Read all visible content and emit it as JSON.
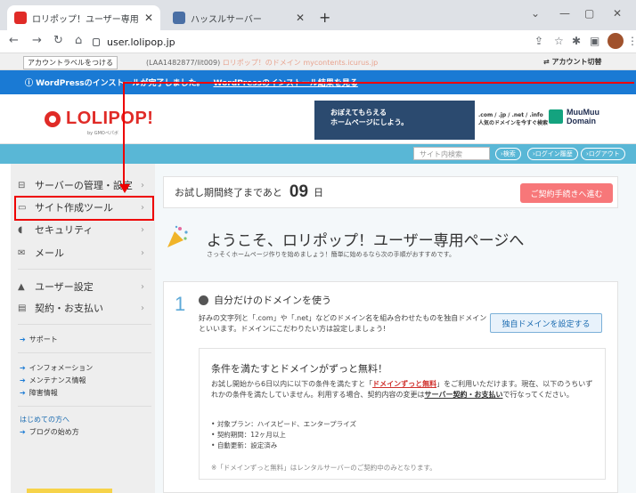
{
  "browser": {
    "tabs": [
      {
        "title": "ロリポップ！ユーザー専用ページ - イン",
        "active": true,
        "favicon_color": "#e02b27"
      },
      {
        "title": "ハッスルサーバー",
        "active": false,
        "favicon_color": "#4a6fa5"
      }
    ],
    "url": "user.lolipop.jp",
    "icons": [
      "back-icon",
      "forward-icon",
      "reload-icon",
      "home-icon",
      "lock-icon",
      "share-icon",
      "star-icon",
      "extensions-icon",
      "sidepanel-icon",
      "profile-avatar",
      "menu-icon"
    ]
  },
  "account_bar": {
    "label_button": "アカウントラベルをつける",
    "info_prefix": "(LAA1482877/lit009)",
    "info_domain": "ロリポップ！のドメイン mycontents.icurus.jp",
    "switch": "⇄ アカウント切替"
  },
  "notice": {
    "text": "ⓘ WordPressのインストールが完了しました。",
    "link": "WordPressのインストール結果を見る"
  },
  "header": {
    "logo": "LOLIPOP!",
    "logo_sub": "by GMOペパボ",
    "banner_line1": "おぼえてもらえる",
    "banner_line2": "ホームページにしよう。",
    "domain_text1": ".com / .jp / .net / .info",
    "domain_text2": "人気のドメインを今すぐ検索",
    "mm_line1": "MuuMuu",
    "mm_line2": "Domain"
  },
  "search": {
    "placeholder": "サイト内検索",
    "btn_search": "›検索",
    "btn_history": "›ログイン履歴",
    "btn_logout": "›ログアウト"
  },
  "sidebar": {
    "items": [
      {
        "icon": "server-icon",
        "glyph": "⊟",
        "label": "サーバーの管理・設定"
      },
      {
        "icon": "site-icon",
        "glyph": "▭",
        "label": "サイト作成ツール"
      },
      {
        "icon": "shield-icon",
        "glyph": "◖",
        "label": "セキュリティ"
      },
      {
        "icon": "mail-icon",
        "glyph": "✉",
        "label": "メール"
      },
      {
        "icon": "user-icon",
        "glyph": "▲",
        "label": "ユーザー設定"
      },
      {
        "icon": "billing-icon",
        "glyph": "▤",
        "label": "契約・お支払い"
      }
    ],
    "links": [
      {
        "label": "サポート"
      },
      {
        "label": "インフォメーション"
      },
      {
        "label": "メンテナンス情報"
      },
      {
        "label": "障害情報"
      }
    ],
    "first_time": "はじめての方へ",
    "blog_link": "ブログの始め方"
  },
  "main": {
    "trial_prefix": "お試し期間終了まであと",
    "trial_days": "09",
    "trial_unit": "日",
    "trial_button": "ご契約手続きへ進む",
    "welcome_title": "ようこそ、ロリポップ！ユーザー専用ページへ",
    "welcome_sub": "さっそくホームページ作りを始めましょう！簡単に始めるなら次の手順がおすすめです。",
    "step_number": "1",
    "step_title": "自分だけのドメインを使う",
    "step_desc": "好みの文字列と「.com」や「.net」などのドメイン名を組み合わせたものを独自ドメインといいます。ドメインにこだわりたい方は設定しましょう!",
    "step_button": "独自ドメインを設定する",
    "free_title": "条件を満たすとドメインがずっと無料！",
    "free_text1": "お試し開始から6日以内に以下の条件を満たすと「",
    "free_bold": "ドメインずっと無料",
    "free_text2": "」をご利用いただけます。現在、以下のうちいずれかの条件を満たしていません。利用する場合、契約内容の変更は",
    "free_link": "サーバー契約・お支払い",
    "free_text3": "で行なってください。",
    "conditions": [
      "対象プラン：ハイスピード、エンタープライズ",
      "契約期間：12ヶ月以上",
      "自動更新：設定済み"
    ],
    "free_note": "※「ドメインずっと無料」はレンタルサーバーのご契約中のみとなります。"
  }
}
